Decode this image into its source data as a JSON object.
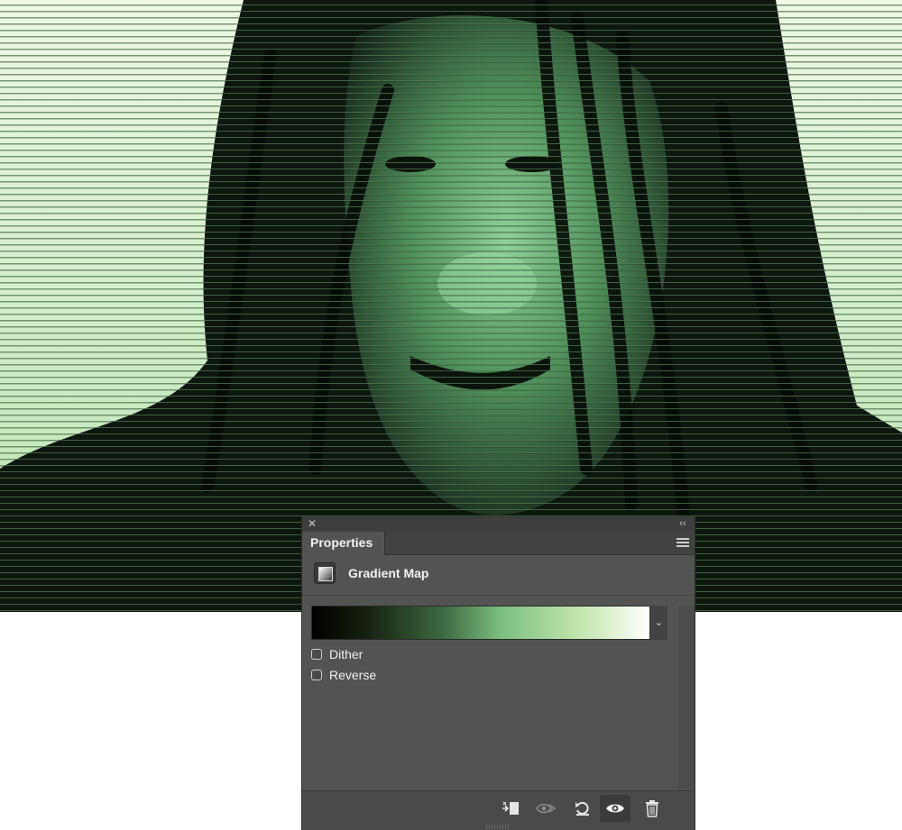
{
  "panel": {
    "tab_label": "Properties",
    "adjustment_title": "Gradient Map",
    "dither_label": "Dither",
    "dither_checked": false,
    "reverse_label": "Reverse",
    "reverse_checked": false,
    "gradient_colors": [
      "#000000",
      "#16200f",
      "#3d6a42",
      "#7cbf80",
      "#bfe3a8",
      "#ffffff"
    ],
    "icons": {
      "close": "close-icon",
      "collapse": "collapse-icon",
      "menu": "panel-menu-icon",
      "adjustment": "gradient-map-icon",
      "dropdown": "chevron-down-icon",
      "clip": "clip-to-layer-icon",
      "view_previous": "view-previous-state-icon",
      "reset": "reset-icon",
      "visibility": "eye-icon",
      "delete": "trash-icon"
    }
  },
  "canvas": {
    "tint_color": "#7cbf80",
    "background_color": "#e2f4d6"
  }
}
